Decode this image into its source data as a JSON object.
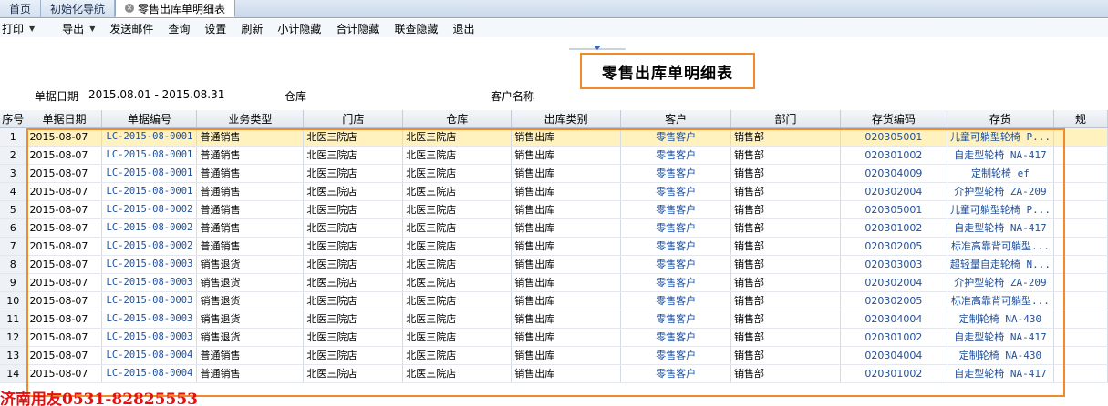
{
  "tabs": [
    {
      "label": "首页"
    },
    {
      "label": "初始化导航"
    },
    {
      "label": "零售出库单明细表"
    }
  ],
  "toolbar": {
    "print": "打印",
    "export": "导出",
    "send_mail": "发送邮件",
    "query": "查询",
    "settings": "设置",
    "refresh": "刷新",
    "subtotal_hide": "小计隐藏",
    "total_hide": "合计隐藏",
    "linked_hide": "联查隐藏",
    "exit": "退出"
  },
  "report": {
    "title": "零售出库单明细表"
  },
  "filters": {
    "date_label": "单据日期",
    "date_value": "2015.08.01 - 2015.08.31",
    "warehouse_label": "仓库",
    "customer_label": "客户名称"
  },
  "table": {
    "columns": [
      "序号",
      "单据日期",
      "单据编号",
      "业务类型",
      "门店",
      "仓库",
      "出库类别",
      "客户",
      "部门",
      "存货编码",
      "存货",
      "规"
    ],
    "rows": [
      {
        "seq": "1",
        "date": "2015-08-07",
        "no": "LC-2015-08-0001",
        "biz": "普通销售",
        "store": "北医三院店",
        "wh": "北医三院店",
        "cat": "销售出库",
        "cust": "零售客户",
        "dept": "销售部",
        "code": "020305001",
        "goods": "儿童可躺型轮椅 P..."
      },
      {
        "seq": "2",
        "date": "2015-08-07",
        "no": "LC-2015-08-0001",
        "biz": "普通销售",
        "store": "北医三院店",
        "wh": "北医三院店",
        "cat": "销售出库",
        "cust": "零售客户",
        "dept": "销售部",
        "code": "020301002",
        "goods": "自走型轮椅 NA-417"
      },
      {
        "seq": "3",
        "date": "2015-08-07",
        "no": "LC-2015-08-0001",
        "biz": "普通销售",
        "store": "北医三院店",
        "wh": "北医三院店",
        "cat": "销售出库",
        "cust": "零售客户",
        "dept": "销售部",
        "code": "020304009",
        "goods": "定制轮椅 ef"
      },
      {
        "seq": "4",
        "date": "2015-08-07",
        "no": "LC-2015-08-0001",
        "biz": "普通销售",
        "store": "北医三院店",
        "wh": "北医三院店",
        "cat": "销售出库",
        "cust": "零售客户",
        "dept": "销售部",
        "code": "020302004",
        "goods": "介护型轮椅 ZA-209"
      },
      {
        "seq": "5",
        "date": "2015-08-07",
        "no": "LC-2015-08-0002",
        "biz": "普通销售",
        "store": "北医三院店",
        "wh": "北医三院店",
        "cat": "销售出库",
        "cust": "零售客户",
        "dept": "销售部",
        "code": "020305001",
        "goods": "儿童可躺型轮椅 P..."
      },
      {
        "seq": "6",
        "date": "2015-08-07",
        "no": "LC-2015-08-0002",
        "biz": "普通销售",
        "store": "北医三院店",
        "wh": "北医三院店",
        "cat": "销售出库",
        "cust": "零售客户",
        "dept": "销售部",
        "code": "020301002",
        "goods": "自走型轮椅 NA-417"
      },
      {
        "seq": "7",
        "date": "2015-08-07",
        "no": "LC-2015-08-0002",
        "biz": "普通销售",
        "store": "北医三院店",
        "wh": "北医三院店",
        "cat": "销售出库",
        "cust": "零售客户",
        "dept": "销售部",
        "code": "020302005",
        "goods": "标准高靠背可躺型..."
      },
      {
        "seq": "8",
        "date": "2015-08-07",
        "no": "LC-2015-08-0003",
        "biz": "销售退货",
        "store": "北医三院店",
        "wh": "北医三院店",
        "cat": "销售出库",
        "cust": "零售客户",
        "dept": "销售部",
        "code": "020303003",
        "goods": "超轻量自走轮椅 N..."
      },
      {
        "seq": "9",
        "date": "2015-08-07",
        "no": "LC-2015-08-0003",
        "biz": "销售退货",
        "store": "北医三院店",
        "wh": "北医三院店",
        "cat": "销售出库",
        "cust": "零售客户",
        "dept": "销售部",
        "code": "020302004",
        "goods": "介护型轮椅 ZA-209"
      },
      {
        "seq": "10",
        "date": "2015-08-07",
        "no": "LC-2015-08-0003",
        "biz": "销售退货",
        "store": "北医三院店",
        "wh": "北医三院店",
        "cat": "销售出库",
        "cust": "零售客户",
        "dept": "销售部",
        "code": "020302005",
        "goods": "标准高靠背可躺型..."
      },
      {
        "seq": "11",
        "date": "2015-08-07",
        "no": "LC-2015-08-0003",
        "biz": "销售退货",
        "store": "北医三院店",
        "wh": "北医三院店",
        "cat": "销售出库",
        "cust": "零售客户",
        "dept": "销售部",
        "code": "020304004",
        "goods": "定制轮椅 NA-430"
      },
      {
        "seq": "12",
        "date": "2015-08-07",
        "no": "LC-2015-08-0003",
        "biz": "销售退货",
        "store": "北医三院店",
        "wh": "北医三院店",
        "cat": "销售出库",
        "cust": "零售客户",
        "dept": "销售部",
        "code": "020301002",
        "goods": "自走型轮椅 NA-417"
      },
      {
        "seq": "13",
        "date": "2015-08-07",
        "no": "LC-2015-08-0004",
        "biz": "普通销售",
        "store": "北医三院店",
        "wh": "北医三院店",
        "cat": "销售出库",
        "cust": "零售客户",
        "dept": "销售部",
        "code": "020304004",
        "goods": "定制轮椅 NA-430"
      },
      {
        "seq": "14",
        "date": "2015-08-07",
        "no": "LC-2015-08-0004",
        "biz": "普通销售",
        "store": "北医三院店",
        "wh": "北医三院店",
        "cat": "销售出库",
        "cust": "零售客户",
        "dept": "销售部",
        "code": "020301002",
        "goods": "自走型轮椅 NA-417"
      }
    ]
  },
  "watermark": "济南用友0531-82825553",
  "colors": {
    "highlight_border": "#f08a2a",
    "selected_row": "#fff2bf",
    "link_blue": "#1f4f9a",
    "watermark_red": "#e3110f"
  }
}
